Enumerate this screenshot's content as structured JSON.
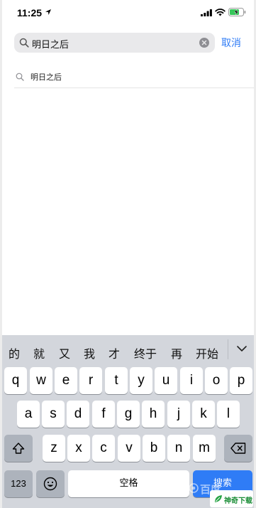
{
  "status_bar": {
    "time": "11:25",
    "icons": [
      "location-arrow-icon",
      "signal-icon",
      "wifi-icon",
      "battery-charging-icon"
    ]
  },
  "search": {
    "query": "明日之后",
    "cancel_label": "取消"
  },
  "suggestions": [
    {
      "label": "明日之后"
    }
  ],
  "keyboard": {
    "candidates": [
      "的",
      "就",
      "又",
      "我",
      "才",
      "终于",
      "再",
      "开始"
    ],
    "row1": [
      "q",
      "w",
      "e",
      "r",
      "t",
      "y",
      "u",
      "i",
      "o",
      "p"
    ],
    "row2": [
      "a",
      "s",
      "d",
      "f",
      "g",
      "h",
      "j",
      "k",
      "l"
    ],
    "row3": [
      "z",
      "x",
      "c",
      "v",
      "b",
      "n",
      "m"
    ],
    "numbers_label": "123",
    "space_label": "空格",
    "search_label": "搜索",
    "accent_color": "#2f7cf6"
  },
  "overlay": {
    "watermark_text": "百度",
    "badge_text": "神奇下载"
  }
}
